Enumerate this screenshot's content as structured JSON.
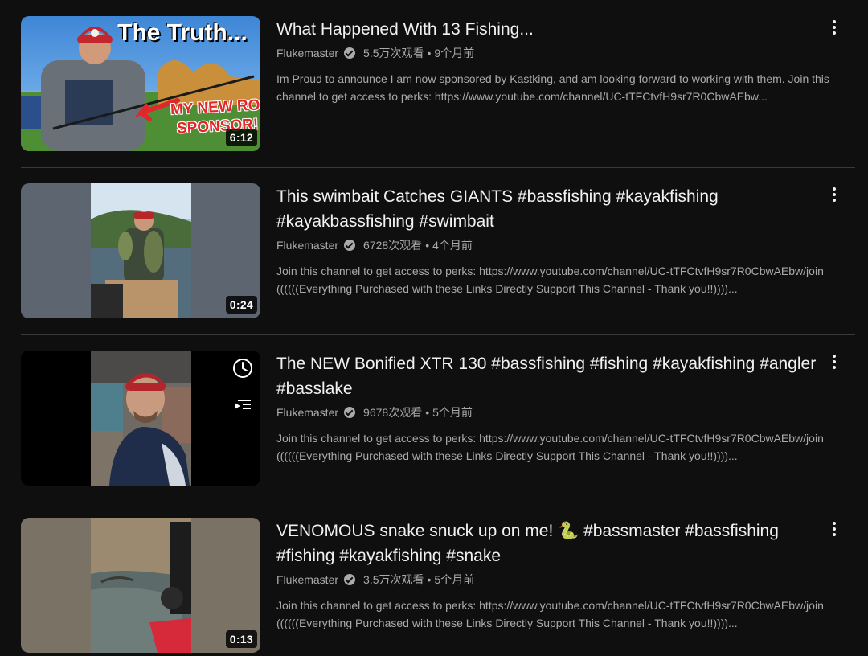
{
  "videos": [
    {
      "title": "What Happened With 13 Fishing...",
      "channel": "Flukemaster",
      "views": "5.5万次观看",
      "age": "9个月前",
      "separator": "•",
      "description": "Im Proud to announce I am now sponsored by Kastking, and am looking forward to working with them. Join this channel to get access to perks: https://www.youtube.com/channel/UC-tTFCtvfH9sr7R0CbwAEbw...",
      "duration": "6:12",
      "thumb_text_1": "The Truth...",
      "thumb_text_2": "MY NEW ROD",
      "thumb_text_3": "SPONSOR!"
    },
    {
      "title": "This swimbait Catches GIANTS #bassfishing #kayakfishing #kayakbassfishing #swimbait",
      "channel": "Flukemaster",
      "views": "6728次观看",
      "age": "4个月前",
      "separator": "•",
      "description": "Join this channel to get access to perks: https://www.youtube.com/channel/UC-tTFCtvfH9sr7R0CbwAEbw/join ((((((Everything Purchased with these Links Directly Support This Channel - Thank you!!))))...",
      "duration": "0:24"
    },
    {
      "title": "The NEW Bonified XTR 130 #bassfishing #fishing #kayakfishing #angler #basslake",
      "channel": "Flukemaster",
      "views": "9678次观看",
      "age": "5个月前",
      "separator": "•",
      "description": "Join this channel to get access to perks: https://www.youtube.com/channel/UC-tTFCtvfH9sr7R0CbwAEbw/join ((((((Everything Purchased with these Links Directly Support This Channel - Thank you!!))))...",
      "duration": ""
    },
    {
      "title": "VENOMOUS snake snuck up on me! 🐍 #bassmaster #bassfishing #fishing #kayakfishing #snake",
      "channel": "Flukemaster",
      "views": "3.5万次观看",
      "age": "5个月前",
      "separator": "•",
      "description": "Join this channel to get access to perks: https://www.youtube.com/channel/UC-tTFCtvfH9sr7R0CbwAEbw/join ((((((Everything Purchased with these Links Directly Support This Channel - Thank you!!))))...",
      "duration": "0:13"
    }
  ],
  "icons": {
    "more": "more-vert-icon",
    "verified": "verified-check-icon",
    "watch_later": "clock-icon",
    "add_to_queue": "add-to-queue-icon"
  },
  "colors": {
    "background": "#0f0f0f",
    "title": "#f1f1f1",
    "secondary": "#aaaaaa",
    "divider": "#3a3a3a",
    "accent_red": "#e3262a"
  }
}
